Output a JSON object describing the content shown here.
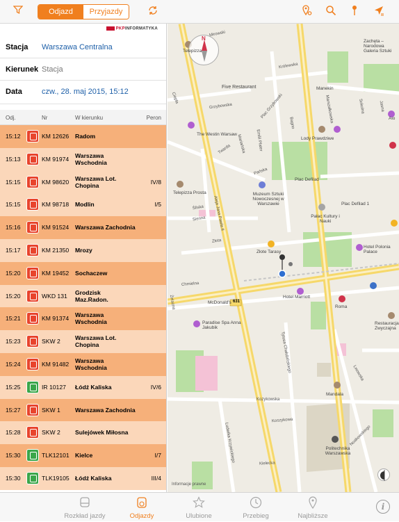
{
  "toolbar": {
    "filter_icon": "filter-icon",
    "segments": {
      "departures": "Odjazd",
      "arrivals": "Przyjazdy"
    },
    "refresh_icon": "refresh-icon",
    "right_icons": [
      "pin-settings-icon",
      "search-icon",
      "pin-icon",
      "location-arrow-icon"
    ]
  },
  "form": {
    "logo_prefix": "PKP",
    "logo_text": "INFORMATYKA",
    "station_label": "Stacja",
    "station_value": "Warszawa Centralna",
    "direction_label": "Kierunek",
    "direction_placeholder": "Stacja",
    "date_label": "Data",
    "date_value": "czw., 28. maj 2015, 15:12"
  },
  "table": {
    "headers": {
      "dep": "Odj.",
      "nr": "Nr",
      "dir": "W kierunku",
      "platform": "Peron"
    },
    "rows": [
      {
        "time": "15:12",
        "icon": "train-icon",
        "nr": "KM 12626",
        "dir": "Radom",
        "platform": "",
        "lines": 1,
        "shade": "dark"
      },
      {
        "time": "15:13",
        "icon": "train-icon",
        "nr": "KM 91974",
        "dir1": "Warszawa",
        "dir2": "Wschodnia",
        "platform": "",
        "lines": 2,
        "shade": "light"
      },
      {
        "time": "15:15",
        "icon": "train-icon",
        "nr": "KM 98620",
        "dir1": "Warszawa Lot.",
        "dir2": "Chopina",
        "platform": "IV/8",
        "lines": 2,
        "shade": "light"
      },
      {
        "time": "15:15",
        "icon": "train-icon",
        "nr": "KM 98718",
        "dir": "Modlin",
        "platform": "I/5",
        "lines": 1,
        "shade": "light"
      },
      {
        "time": "15:16",
        "icon": "train-icon",
        "nr": "KM 91524",
        "dir": "Warszawa Zachodnia",
        "platform": "",
        "lines": 1,
        "shade": "dark"
      },
      {
        "time": "15:17",
        "icon": "train-icon",
        "nr": "KM 21350",
        "dir": "Mrozy",
        "platform": "",
        "lines": 1,
        "shade": "light"
      },
      {
        "time": "15:20",
        "icon": "train-icon",
        "nr": "KM 19452",
        "dir": "Sochaczew",
        "platform": "",
        "lines": 1,
        "shade": "dark"
      },
      {
        "time": "15:20",
        "icon": "train-icon",
        "nr": "WKD 131",
        "dir1": "Grodzisk",
        "dir2": "Maz.Radon.",
        "platform": "",
        "lines": 2,
        "shade": "light"
      },
      {
        "time": "15:21",
        "icon": "train-icon",
        "nr": "KM 91374",
        "dir1": "Warszawa",
        "dir2": "Wschodnia",
        "platform": "",
        "lines": 2,
        "shade": "dark"
      },
      {
        "time": "15:23",
        "icon": "train-icon",
        "nr": "SKW 2",
        "dir1": "Warszawa Lot.",
        "dir2": "Chopina",
        "platform": "",
        "lines": 2,
        "shade": "light"
      },
      {
        "time": "15:24",
        "icon": "train-icon",
        "nr": "KM 91482",
        "dir1": "Warszawa",
        "dir2": "Wschodnia",
        "platform": "",
        "lines": 2,
        "shade": "dark"
      },
      {
        "time": "15:25",
        "icon": "intercity-train-icon",
        "nr": "IR 10127",
        "dir": "Łódź Kaliska",
        "platform": "IV/6",
        "lines": 1,
        "shade": "light",
        "green": true
      },
      {
        "time": "15:27",
        "icon": "train-icon",
        "nr": "SKW 1",
        "dir": "Warszawa Zachodnia",
        "platform": "",
        "lines": 1,
        "shade": "dark"
      },
      {
        "time": "15:28",
        "icon": "train-icon",
        "nr": "SKW 2",
        "dir": "Sulejówek Miłosna",
        "platform": "",
        "lines": 1,
        "shade": "light"
      },
      {
        "time": "15:30",
        "icon": "intercity-train-icon",
        "nr": "TLK12101",
        "dir": "Kielce",
        "platform": "I/7",
        "lines": 1,
        "shade": "dark",
        "green": true
      },
      {
        "time": "15:30",
        "icon": "intercity-train-icon",
        "nr": "TLK19105",
        "dir": "Łódź Kaliska",
        "platform": "III/4",
        "lines": 1,
        "shade": "light",
        "green": true
      }
    ]
  },
  "map": {
    "labels": [
      {
        "text": "Telepizza",
        "x": ""
      },
      {
        "text": "Five Restaurant"
      },
      {
        "text": "The Westin Warsaw"
      },
      {
        "text": "Manekin"
      },
      {
        "text": "Lody Prawdziwe"
      },
      {
        "text": "Zachęta – Narodowa Galeria Sztuki"
      },
      {
        "text": "Aio"
      },
      {
        "text": "Telepizza Prosta"
      },
      {
        "text": "Muzeum Sztuki Nowoczesnej w Warszawie"
      },
      {
        "text": "Plac Defilad"
      },
      {
        "text": "Plac Defilad 1"
      },
      {
        "text": "Pałac Kultury i Nauki"
      },
      {
        "text": "Złote Tarasy"
      },
      {
        "text": "Hotel Polonia Palace"
      },
      {
        "text": "Hotel Marriott"
      },
      {
        "text": "McDonald's"
      },
      {
        "text": "Paradise Spa Anna Jakubik"
      },
      {
        "text": "Roma"
      },
      {
        "text": "Restauracja Zwyczajna"
      },
      {
        "text": "Mandala"
      },
      {
        "text": "Politechnika Warszawska"
      },
      {
        "text": "Informacje prawne"
      }
    ],
    "streets": [
      "Mirowski",
      "Królewska",
      "Marszałkowska",
      "Grzybowska",
      "Plac Grzybowski",
      "Twarda",
      "Bagno",
      "Mariańska",
      "Emilii Plater",
      "Pańska",
      "Śliska",
      "Sienna",
      "Złota",
      "Chmielna",
      "Aleja Jana Pawła II",
      "Żelazna",
      "Tytusa Chałubińskiego",
      "Kozykowska",
      "Noakowskiego",
      "Ludwika Krzywickiego",
      "Lwowska",
      "Koszykowa",
      "Kielecka",
      "Jasna",
      "Sokolna",
      "Ciepła"
    ],
    "route_badge": "631",
    "compass_letter": "N",
    "tracking_icon": "tracking-icon"
  },
  "tabs": [
    {
      "label": "Rozkład jazdy",
      "icon": "timetable-icon",
      "active": false
    },
    {
      "label": "Odjazdy",
      "icon": "departures-icon",
      "active": true
    },
    {
      "label": "Ulubione",
      "icon": "star-icon",
      "active": false
    },
    {
      "label": "Przebieg",
      "icon": "clock-icon",
      "active": false
    },
    {
      "label": "Najbliższe",
      "icon": "location-pin-icon",
      "active": false
    }
  ],
  "info_icon": "info-icon"
}
